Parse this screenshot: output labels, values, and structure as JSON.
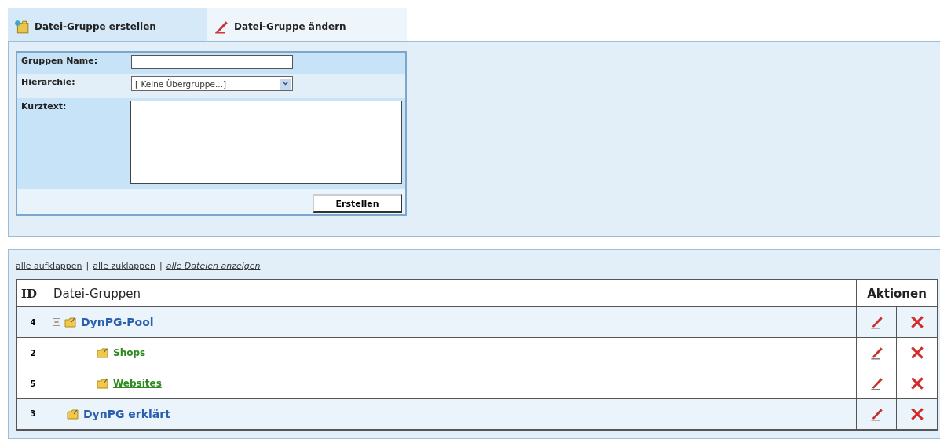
{
  "tabs": [
    {
      "label": "Datei-Gruppe erstellen",
      "selected": true,
      "kind": "create"
    },
    {
      "label": "Datei-Gruppe ändern",
      "selected": false,
      "kind": "edit"
    }
  ],
  "form": {
    "fields": [
      {
        "label": "Gruppen Name:",
        "kind": "text"
      },
      {
        "label": "Hierarchie:",
        "kind": "select",
        "value": "[ Keine Übergruppe...]"
      },
      {
        "label": "Kurztext:",
        "kind": "textarea"
      }
    ],
    "submit": "Erstellen"
  },
  "links": [
    {
      "label": "alle aufklappen",
      "kind": "plain"
    },
    {
      "label": "alle zuklappen",
      "kind": "plain"
    },
    {
      "label": "alle Dateien anzeigen",
      "kind": "emphasized"
    }
  ],
  "link_separator": "|",
  "table": {
    "columns": [
      "ID",
      "Datei-Gruppen",
      "Aktionen"
    ],
    "rows": [
      {
        "id": "4",
        "name": "DynPG-Pool",
        "expanded": true,
        "children": [
          {
            "id": "2",
            "name": "Shops"
          },
          {
            "id": "5",
            "name": "Websites"
          }
        ]
      },
      {
        "id": "3",
        "name": "DynPG erklärt"
      }
    ]
  }
}
